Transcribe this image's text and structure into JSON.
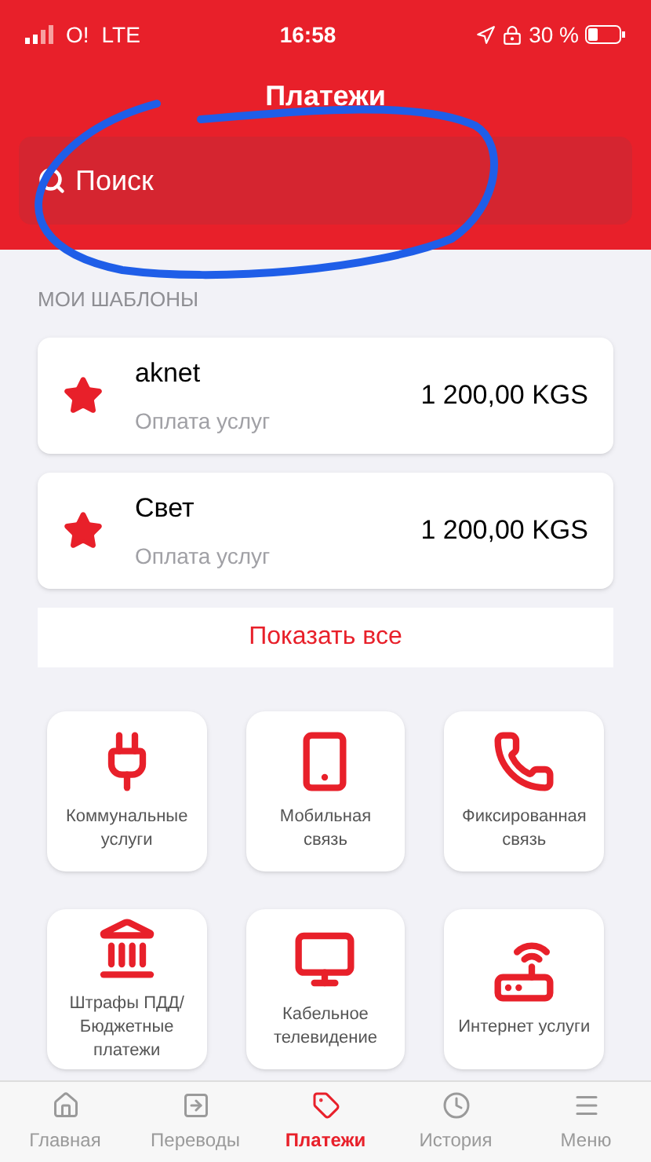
{
  "status_bar": {
    "carrier": "O!",
    "network": "LTE",
    "time": "16:58",
    "battery": "30 %"
  },
  "header": {
    "title": "Платежи",
    "search": {
      "placeholder": "Поиск"
    }
  },
  "templates": {
    "heading": "МОИ ШАБЛОНЫ",
    "items": [
      {
        "name": "aknet",
        "category": "Оплата услуг",
        "amount": "1 200,00 KGS"
      },
      {
        "name": "Свет",
        "category": "Оплата услуг",
        "amount": "1 200,00 KGS"
      }
    ],
    "show_all": "Показать все"
  },
  "categories": [
    {
      "label": "Коммунальные услуги"
    },
    {
      "label": "Мобильная связь"
    },
    {
      "label": "Фиксированная связь"
    },
    {
      "label": "Штрафы ПДД/ Бюджетные платежи"
    },
    {
      "label": "Кабельное телевидение"
    },
    {
      "label": "Интернет услуги"
    }
  ],
  "tab_bar": [
    {
      "label": "Главная",
      "selected": false
    },
    {
      "label": "Переводы",
      "selected": false
    },
    {
      "label": "Платежи",
      "selected": true
    },
    {
      "label": "История",
      "selected": false
    },
    {
      "label": "Меню",
      "selected": false
    }
  ]
}
